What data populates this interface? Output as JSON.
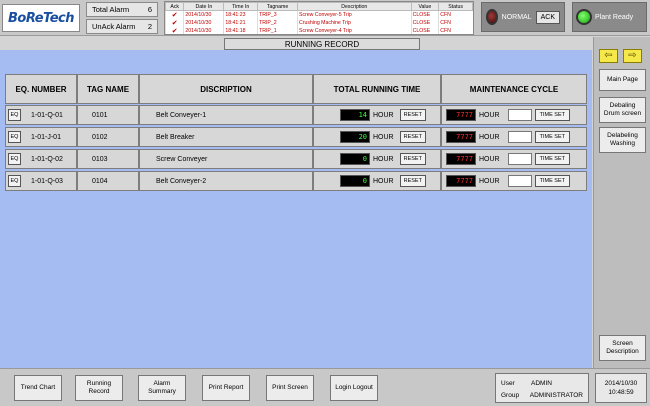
{
  "header": {
    "logo": "BoReTech",
    "alarm_counts": [
      {
        "label": "Total Alarm",
        "value": "6"
      },
      {
        "label": "UnAck Alarm",
        "value": "2"
      }
    ],
    "alarm_table": {
      "columns": [
        "Ack",
        "Date In",
        "Time In",
        "Tagname",
        "Description",
        "Value",
        "Status"
      ],
      "rows": [
        {
          "ack": "✔",
          "date": "2014/10/30",
          "time": "18:41:23",
          "tag": "TRIP_3",
          "desc": "Screw Conveyer-5 Trip",
          "value": "CLOSE",
          "status": "CFN"
        },
        {
          "ack": "✔",
          "date": "2014/10/30",
          "time": "18:41:21",
          "tag": "TRIP_2",
          "desc": "Crushing Machine Trip",
          "value": "CLOSE",
          "status": "CFN"
        },
        {
          "ack": "✔",
          "date": "2014/10/30",
          "time": "18:41:18",
          "tag": "TRIP_1",
          "desc": "Screw Conveyer-4 Trip",
          "value": "CLOSE",
          "status": "CFN"
        }
      ]
    },
    "status": {
      "label": "NORMAL",
      "ack_label": "ACK"
    },
    "plant": {
      "label": "Plant Ready"
    }
  },
  "title": "RUNNING RECORD",
  "table": {
    "headers": [
      "EQ. NUMBER",
      "TAG NAME",
      "DISCRIPTION",
      "TOTAL RUNNING TIME",
      "MAINTENANCE CYCLE"
    ],
    "rows": [
      {
        "eq_btn": "EQ",
        "eq_number": "1-01-Q-01",
        "tag": "0101",
        "desc": "Belt Conveyer-1",
        "run": "14",
        "run_unit": "HOUR",
        "reset": "RESET",
        "cycle": "7777",
        "cycle_unit": "HOUR",
        "timeset": "TIME SET"
      },
      {
        "eq_btn": "EQ",
        "eq_number": "1-01-J-01",
        "tag": "0102",
        "desc": "Belt Breaker",
        "run": "20",
        "run_unit": "HOUR",
        "reset": "RESET",
        "cycle": "7777",
        "cycle_unit": "HOUR",
        "timeset": "TIME SET"
      },
      {
        "eq_btn": "EQ",
        "eq_number": "1-01-Q-02",
        "tag": "0103",
        "desc": "Screw Conveyer",
        "run": "0",
        "run_unit": "HOUR",
        "reset": "RESET",
        "cycle": "7777",
        "cycle_unit": "HOUR",
        "timeset": "TIME SET"
      },
      {
        "eq_btn": "EQ",
        "eq_number": "1-01-Q-03",
        "tag": "0104",
        "desc": "Belt Conveyer-2",
        "run": "0",
        "run_unit": "HOUR",
        "reset": "RESET",
        "cycle": "7777",
        "cycle_unit": "HOUR",
        "timeset": "TIME SET"
      }
    ]
  },
  "nav": {
    "arrows": {
      "left_icon": "arrow-left-icon",
      "right_icon": "arrow-right-icon"
    },
    "items": [
      "Main Page",
      "Debaling Drum screen",
      "Delabeling Washing"
    ],
    "screen_description": "Screen Description"
  },
  "footer": {
    "buttons": [
      "Trend Chart",
      "Running Record",
      "Alarm Summary",
      "Print Report",
      "Print Screen",
      "Login Logout"
    ],
    "user_label": "User",
    "user": "ADMIN",
    "group_label": "Group",
    "group": "ADMINISTRATOR",
    "date": "2014/10/30",
    "time": "10:48:59"
  },
  "colors": {
    "main_bg": "#a4bcf2",
    "run_digit": "#3cff3c",
    "cycle_digit": "#ff2a2a",
    "alarm_text": "#c00000"
  }
}
